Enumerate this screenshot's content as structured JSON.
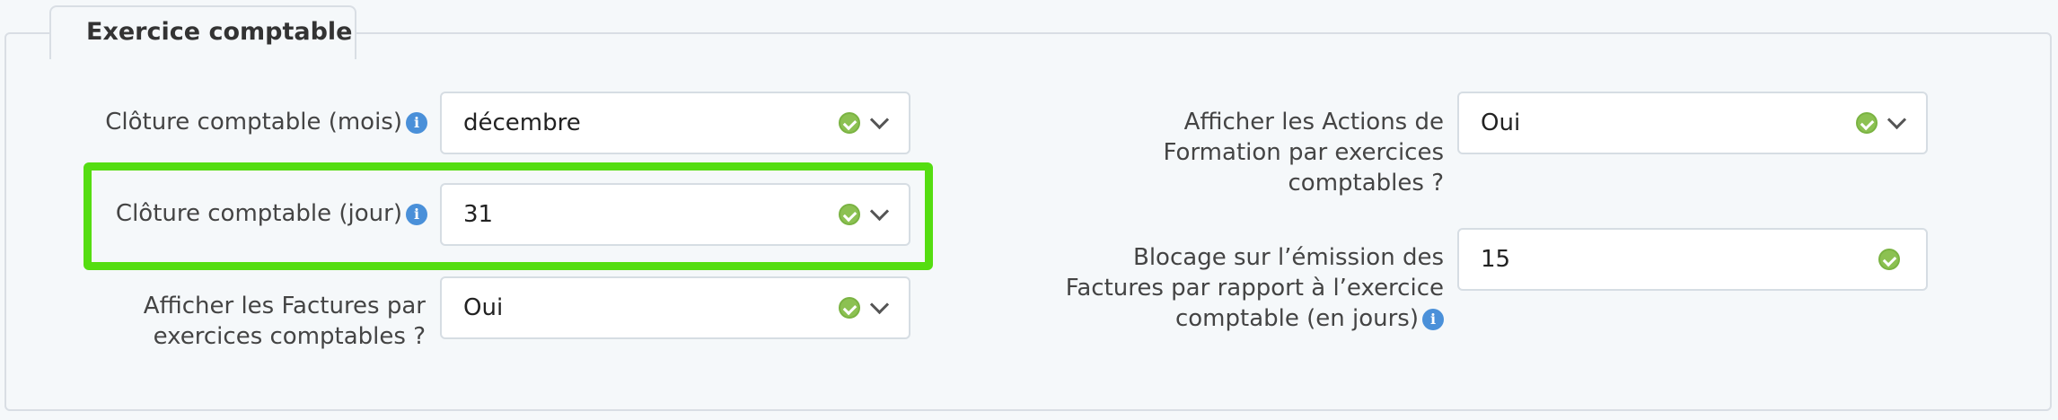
{
  "fieldset": {
    "legend": "Exercice comptable"
  },
  "left_column": {
    "cloture_mois": {
      "label": "Clôture comptable (mois)",
      "value": "décembre",
      "info": "i"
    },
    "cloture_jour": {
      "label": "Clôture comptable (jour)",
      "value": "31",
      "info": "i"
    },
    "afficher_factures": {
      "label_line1": "Afficher les Factures par",
      "label_line2": "exercices comptables ?",
      "value": "Oui"
    }
  },
  "right_column": {
    "afficher_actions": {
      "label_line1": "Afficher les Actions de",
      "label_line2": "Formation par exercices",
      "label_line3": "comptables ?",
      "value": "Oui"
    },
    "blocage_emission": {
      "label_line1": "Blocage sur l’émission des",
      "label_line2": "Factures par rapport à l’exercice",
      "label_line3": "comptable (en jours)",
      "value": "15",
      "info": "i"
    }
  },
  "colors": {
    "highlight": "#55dd11",
    "valid_check": "#8cc152",
    "info": "#4a90d9"
  }
}
